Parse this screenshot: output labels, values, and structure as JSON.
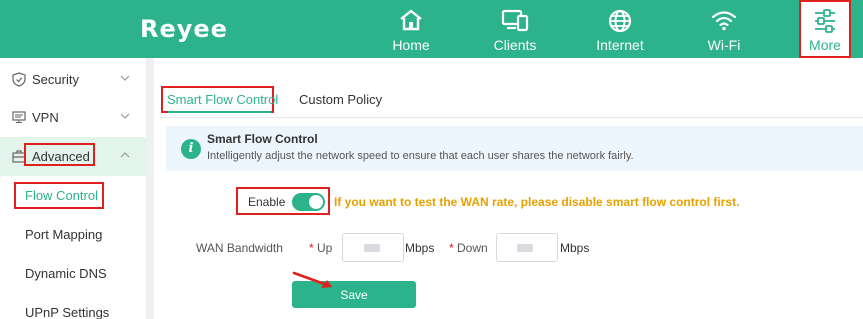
{
  "brand": "Reyee",
  "nav": [
    {
      "id": "home",
      "label": "Home",
      "icon": "home-icon"
    },
    {
      "id": "clients",
      "label": "Clients",
      "icon": "devices-icon"
    },
    {
      "id": "internet",
      "label": "Internet",
      "icon": "globe-icon"
    },
    {
      "id": "wifi",
      "label": "Wi-Fi",
      "icon": "wifi-icon"
    },
    {
      "id": "more",
      "label": "More",
      "icon": "sliders-icon",
      "selected": true
    }
  ],
  "sidebar": {
    "items": [
      {
        "label": "Security",
        "icon": "shield-icon",
        "expanded": false
      },
      {
        "label": "VPN",
        "icon": "monitor-icon",
        "expanded": false
      },
      {
        "label": "Advanced",
        "icon": "toolbox-icon",
        "expanded": true
      }
    ],
    "subitems": [
      {
        "label": "Flow Control",
        "selected": true
      },
      {
        "label": "Port Mapping"
      },
      {
        "label": "Dynamic DNS"
      },
      {
        "label": "UPnP Settings"
      }
    ]
  },
  "tabs": [
    {
      "label": "Smart Flow Control",
      "active": true
    },
    {
      "label": "Custom Policy",
      "active": false
    }
  ],
  "info": {
    "title": "Smart Flow Control",
    "description": "Intelligently adjust the network speed to ensure that each user shares the network fairly."
  },
  "form": {
    "enable_label": "Enable",
    "enable_on": true,
    "warning": "If you want to test the WAN rate, please disable smart flow control first.",
    "wan_bandwidth_label": "WAN Bandwidth",
    "up_label": "Up",
    "down_label": "Down",
    "up_value": "",
    "down_value": "",
    "unit": "Mbps",
    "save_label": "Save"
  },
  "colors": {
    "accent": "#2db38c",
    "warning": "#e6a100",
    "highlight": "#e0201c"
  }
}
